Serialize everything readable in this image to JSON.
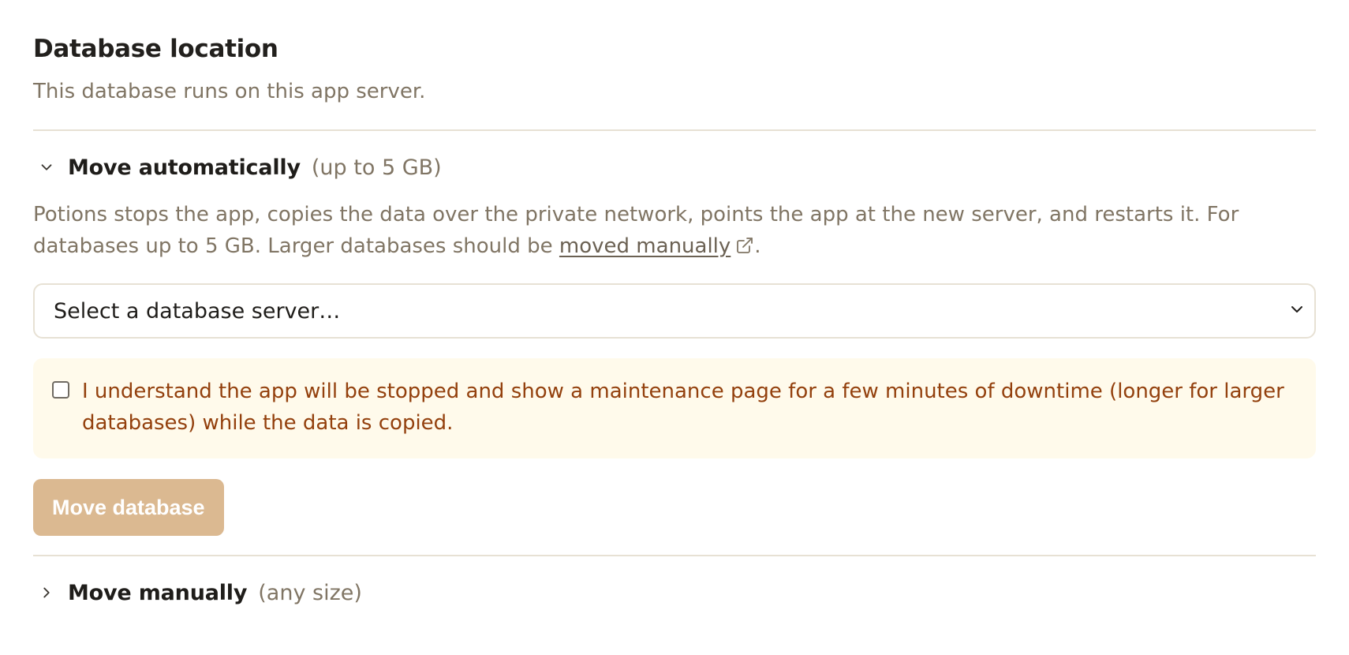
{
  "section": {
    "title": "Database location",
    "description": "This database runs on this app server."
  },
  "auto": {
    "title": "Move automatically",
    "hint": "(up to 5 GB)",
    "expanded": true,
    "body_before_link": "Potions stops the app, copies the data over the private network, points the app at the new server, and restarts it. For databases up to 5 GB. Larger databases should be ",
    "link_text": "moved manually",
    "body_after_link": ".",
    "select": {
      "value": "Select a database server…"
    },
    "confirm": {
      "checked": false,
      "text": "I understand the app will be stopped and show a maintenance page for a few minutes of downtime (longer for larger databases) while the data is copied."
    },
    "button_label": "Move database"
  },
  "manual": {
    "title": "Move manually",
    "hint": "(any size)",
    "expanded": false
  },
  "icons": {
    "auto_toggle": "chevron-down-icon",
    "manual_toggle": "chevron-right-icon",
    "link": "external-link-icon",
    "select_caret": "chevron-down-icon"
  },
  "colors": {
    "muted_text": "#807564",
    "warning_text": "#93400d",
    "warning_bg": "#fffaeb",
    "button_disabled_bg": "#dbb991",
    "divider": "#e7e1d4"
  }
}
